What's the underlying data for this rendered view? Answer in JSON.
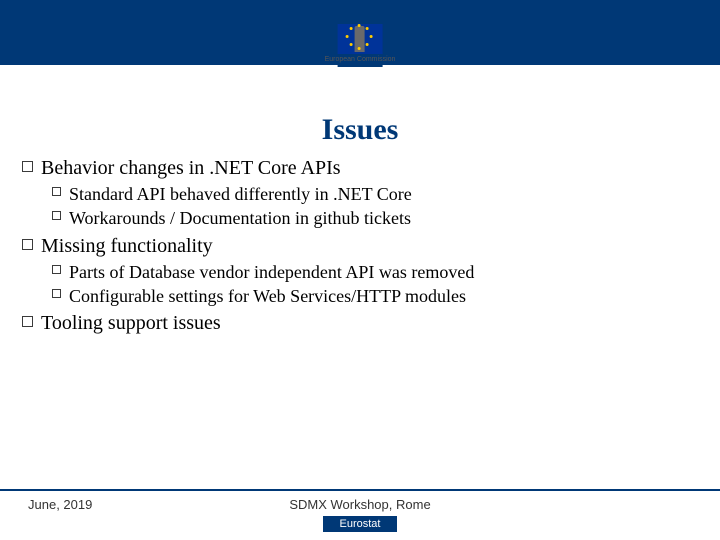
{
  "header": {
    "logo_label": "European\nCommission"
  },
  "title": "Issues",
  "bullets": [
    {
      "text": "Behavior changes in .NET Core APIs",
      "children": [
        {
          "text": "Standard API behaved differently in .NET Core"
        },
        {
          "text": "Workarounds / Documentation in github tickets"
        }
      ]
    },
    {
      "text": "Missing functionality",
      "children": [
        {
          "text": "Parts of Database vendor independent API was removed"
        },
        {
          "text": "Configurable settings for Web Services/HTTP modules"
        }
      ]
    },
    {
      "text": "Tooling support issues",
      "children": []
    }
  ],
  "footer": {
    "date": "June, 2019",
    "venue": "SDMX Workshop, Rome",
    "tag": "Eurostat"
  }
}
